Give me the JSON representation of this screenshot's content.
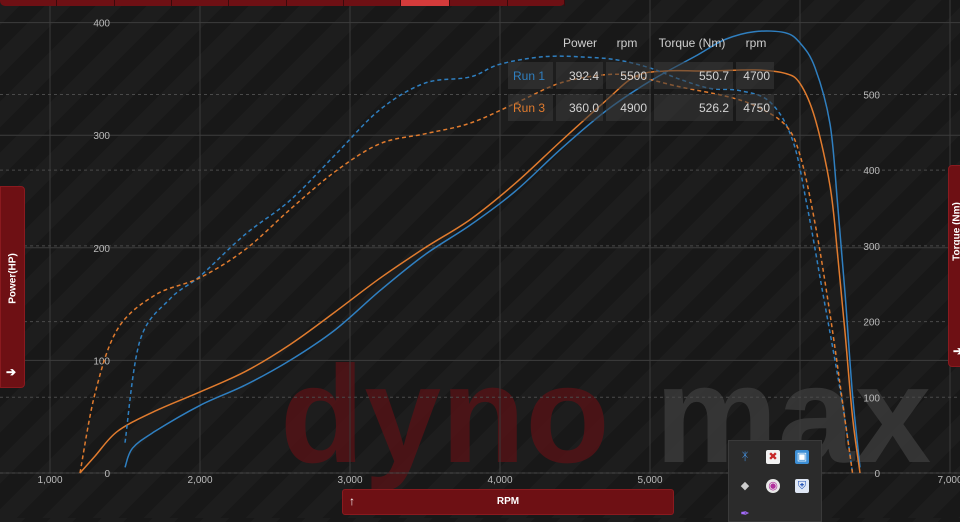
{
  "chart_data": {
    "type": "line",
    "watermark": {
      "part1": "dyno",
      "part2": "max"
    },
    "xlabel": "RPM",
    "y_left_label": "Power(HP)",
    "y_right_label": "Torque (Nm)",
    "xlim": [
      1000,
      7000
    ],
    "y_left_lim": [
      0,
      400
    ],
    "y_right_lim": [
      0,
      550
    ],
    "x_ticks": [
      "1,000",
      "2,000",
      "3,000",
      "4,000",
      "5,000",
      "6,000",
      "7,000"
    ],
    "y_left_ticks": [
      "0",
      "100",
      "200",
      "300",
      "400"
    ],
    "y_right_ticks": [
      "0",
      "100",
      "200",
      "300",
      "400",
      "500"
    ],
    "grid": true,
    "legend_position": "top-right",
    "series": [
      {
        "name": "Run 1",
        "quantity": "power",
        "color": "#2f7fc0",
        "dashed": false,
        "x": [
          1500,
          1550,
          1700,
          2000,
          2300,
          2600,
          2900,
          3200,
          3500,
          3800,
          4100,
          4400,
          4700,
          5000,
          5300,
          5500,
          5700,
          5900,
          6000,
          6100,
          6200,
          6250,
          6300,
          6350,
          6400
        ],
        "y": [
          5,
          22,
          37,
          60,
          78,
          100,
          127,
          162,
          194,
          220,
          250,
          287,
          321,
          348,
          370,
          385,
          392,
          391,
          382,
          360,
          310,
          240,
          160,
          70,
          5
        ]
      },
      {
        "name": "Run 3",
        "quantity": "power",
        "color": "#e07b2e",
        "dashed": false,
        "x": [
          1200,
          1300,
          1450,
          1700,
          2000,
          2300,
          2600,
          2900,
          3200,
          3500,
          3800,
          4100,
          4400,
          4700,
          4900,
          5100,
          5400,
          5700,
          5900,
          6000,
          6100,
          6200,
          6250,
          6300,
          6350,
          6400
        ],
        "y": [
          0,
          15,
          37,
          55,
          72,
          90,
          114,
          143,
          173,
          200,
          225,
          257,
          294,
          330,
          352,
          357,
          357,
          358,
          355,
          346,
          315,
          255,
          195,
          125,
          50,
          0
        ]
      },
      {
        "name": "Run 1",
        "quantity": "torque",
        "color": "#2f7fc0",
        "dashed": true,
        "x": [
          1500,
          1600,
          1800,
          2000,
          2300,
          2600,
          2900,
          3200,
          3500,
          3800,
          4000,
          4300,
          4600,
          4800,
          5000,
          5200,
          5400,
          5600,
          5800,
          5950,
          6050,
          6150,
          6250,
          6300,
          6350
        ],
        "y": [
          40,
          175,
          230,
          260,
          315,
          360,
          420,
          480,
          515,
          523,
          540,
          550,
          549,
          545,
          535,
          520,
          508,
          505,
          490,
          440,
          350,
          240,
          130,
          70,
          0
        ]
      },
      {
        "name": "Run 3",
        "quantity": "torque",
        "color": "#e07b2e",
        "dashed": true,
        "x": [
          1200,
          1300,
          1450,
          1700,
          2000,
          2300,
          2600,
          2900,
          3200,
          3500,
          3800,
          4100,
          4400,
          4700,
          4900,
          5200,
          5500,
          5700,
          5900,
          6000,
          6100,
          6200,
          6300,
          6350
        ],
        "y": [
          0,
          105,
          190,
          235,
          258,
          295,
          348,
          398,
          435,
          448,
          462,
          488,
          515,
          526,
          524,
          510,
          498,
          485,
          460,
          420,
          330,
          210,
          70,
          0
        ]
      }
    ],
    "readout": {
      "headers": [
        "Power",
        "rpm",
        "Torque (Nm)",
        "rpm"
      ],
      "rows": [
        {
          "name": "Run 1",
          "power": "392.4",
          "power_rpm": "5500",
          "torque": "550.7",
          "torque_rpm": "4700"
        },
        {
          "name": "Run 3",
          "power": "360.0",
          "power_rpm": "4900",
          "torque": "526.2",
          "torque_rpm": "4750"
        }
      ]
    }
  },
  "ui": {
    "x_axis_button_icon": "arrow-up-icon",
    "left_panel_icon": "arrow-right-icon",
    "right_panel_icon": "arrow-right-icon",
    "tray_icons": [
      "bluetooth-icon",
      "shield-icon",
      "display-icon",
      "diamond-icon",
      "chrome-icon",
      "defender-icon",
      "feather-icon"
    ]
  }
}
